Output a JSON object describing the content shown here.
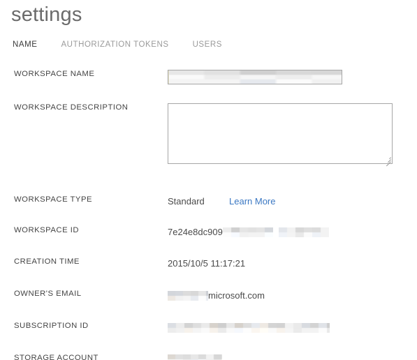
{
  "page": {
    "title": "settings"
  },
  "tabs": [
    {
      "label": "NAME",
      "active": true
    },
    {
      "label": "AUTHORIZATION TOKENS",
      "active": false
    },
    {
      "label": "USERS",
      "active": false
    }
  ],
  "fields": {
    "workspace_name": {
      "label": "WORKSPACE NAME",
      "value": "",
      "redacted": true,
      "redaction_width": 58
    },
    "workspace_description": {
      "label": "WORKSPACE DESCRIPTION",
      "value": "",
      "placeholder": ""
    },
    "workspace_type": {
      "label": "WORKSPACE TYPE",
      "value": "Standard",
      "link_label": "Learn More"
    },
    "workspace_id": {
      "label": "WORKSPACE ID",
      "value_visible": "7e24e8dc909",
      "redacted": true
    },
    "creation_time": {
      "label": "CREATION TIME",
      "value": "2015/10/5 11:17:21"
    },
    "owner_email": {
      "label": "OWNER'S EMAIL",
      "value_visible": "microsoft.com",
      "redacted": true
    },
    "subscription_id": {
      "label": "SUBSCRIPTION ID",
      "value": "",
      "redacted": true
    },
    "storage_account": {
      "label": "STORAGE ACCOUNT",
      "value": "",
      "redacted": true
    }
  },
  "colors": {
    "title": "#6b6b6b",
    "label": "#444444",
    "value": "#4a4a4a",
    "tab_active": "#3a3a3a",
    "tab_inactive": "#9a9a9a",
    "link": "#3b78c3",
    "input_border": "#a6a6a6",
    "background": "#ffffff"
  }
}
